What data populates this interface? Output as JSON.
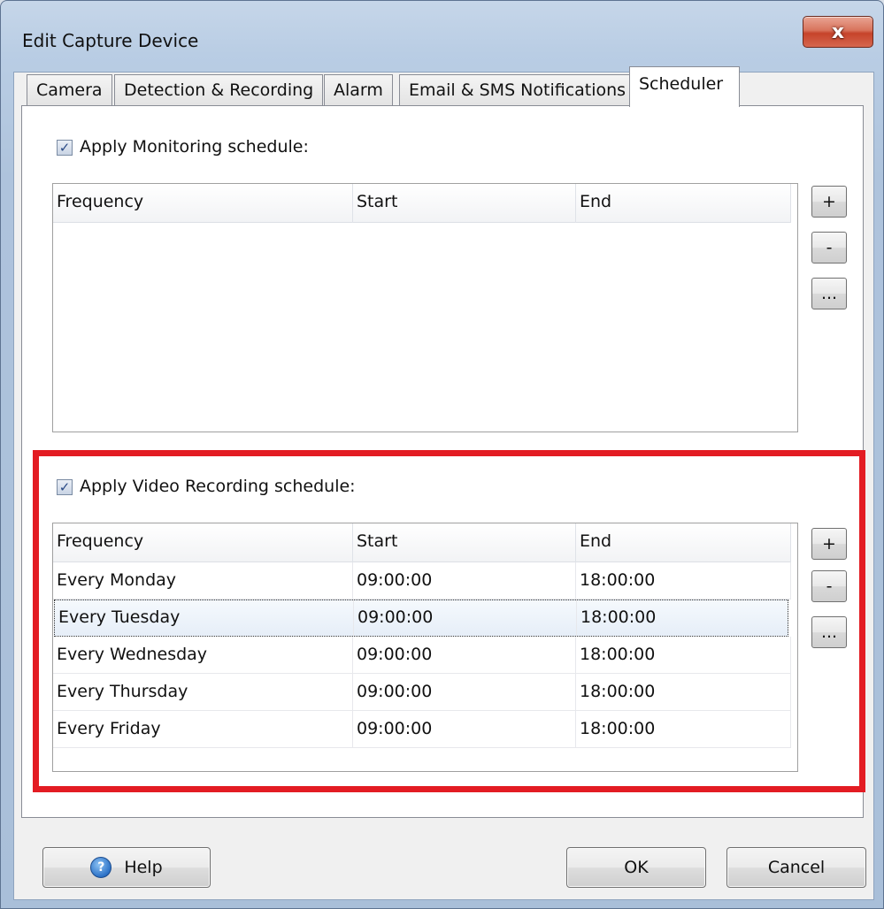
{
  "window": {
    "title": "Edit Capture Device",
    "close_glyph": "x"
  },
  "tabs": [
    {
      "label": "Camera"
    },
    {
      "label": "Detection & Recording"
    },
    {
      "label": "Alarm"
    },
    {
      "label": "Email & SMS Notifications"
    },
    {
      "label": "Scheduler",
      "active": true
    }
  ],
  "monitoring": {
    "checkbox_label": "Apply Monitoring schedule:",
    "checked": true,
    "columns": [
      "Frequency",
      "Start",
      "End"
    ],
    "rows": []
  },
  "recording": {
    "checkbox_label": "Apply Video Recording schedule:",
    "checked": true,
    "columns": [
      "Frequency",
      "Start",
      "End"
    ],
    "rows": [
      {
        "frequency": "Every Monday",
        "start": "09:00:00",
        "end": "18:00:00"
      },
      {
        "frequency": "Every Tuesday",
        "start": "09:00:00",
        "end": "18:00:00"
      },
      {
        "frequency": "Every Wednesday",
        "start": "09:00:00",
        "end": "18:00:00"
      },
      {
        "frequency": "Every Thursday",
        "start": "09:00:00",
        "end": "18:00:00"
      },
      {
        "frequency": "Every Friday",
        "start": "09:00:00",
        "end": "18:00:00"
      }
    ]
  },
  "side_buttons": {
    "add": "+",
    "remove": "-",
    "edit": "..."
  },
  "footer": {
    "help": "Help",
    "help_icon": "?",
    "ok": "OK",
    "cancel": "Cancel"
  },
  "colors": {
    "highlight": "#e31c23"
  }
}
